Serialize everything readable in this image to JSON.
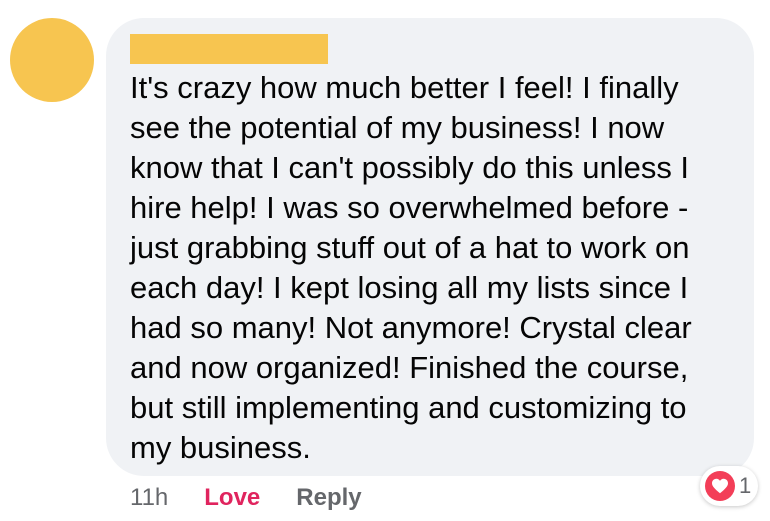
{
  "comment": {
    "author_redacted_color": "#f7c550",
    "avatar_color": "#f7c550",
    "text": "It's crazy how much better I feel!  I finally\nsee the potential of my business! I now\nknow that I can't possibly do this unless I\nhire help!  I was so overwhelmed before -\njust grabbing stuff out of a hat to work on\neach day! I kept losing all my lists since I\nhad so many! Not anymore! Crystal clear\nand now organized!  Finished the course,\nbut still implementing and customizing to\nmy business.",
    "bubble_color": "#f0f2f5"
  },
  "actions": {
    "timestamp": "11h",
    "love_label": "Love",
    "reply_label": "Reply",
    "love_color": "#e0245e"
  },
  "reaction": {
    "icon": "heart-icon",
    "icon_color": "#f33e58",
    "count": "1"
  }
}
